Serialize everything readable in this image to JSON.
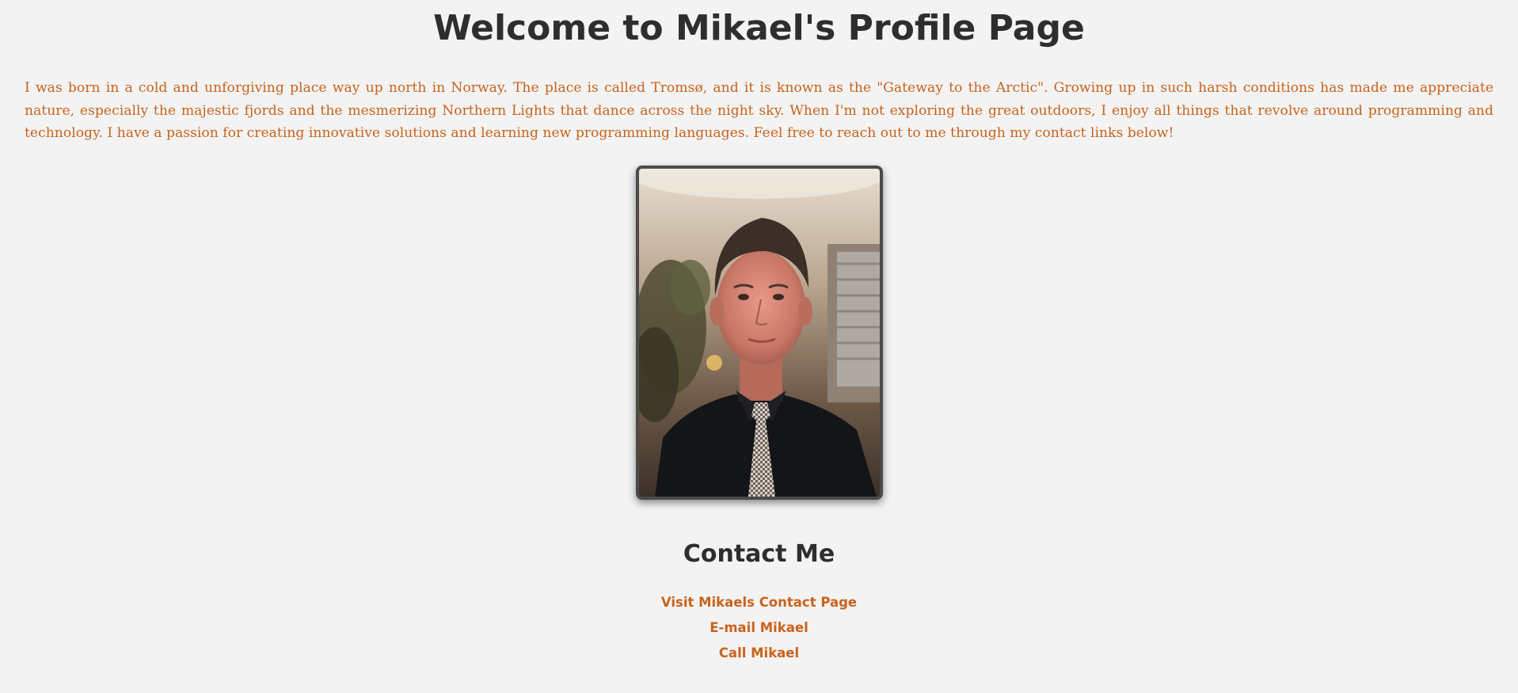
{
  "header": {
    "title": "Welcome to Mikael's Profile Page"
  },
  "bio": {
    "text": "I was born in a cold and unforgiving place way up north in Norway. The place is called Tromsø, and it is known as the \"Gateway to the Arctic\". Growing up in such harsh conditions has made me appreciate nature, especially the majestic fjords and the mesmerizing Northern Lights that dance across the night sky. When I'm not exploring the great outdoors, I enjoy all things that revolve around programming and technology. I have a passion for creating innovative solutions and learning new programming languages. Feel free to reach out to me through my contact links below!"
  },
  "photo": {
    "subject": "portrait of a man in dark shirt and checkered tie"
  },
  "contact": {
    "heading": "Contact Me",
    "links": [
      {
        "label": "Visit Mikaels Contact Page"
      },
      {
        "label": "E-mail Mikael"
      },
      {
        "label": "Call Mikael"
      }
    ]
  },
  "colors": {
    "background": "#f3f3f3",
    "heading": "#2e2e2e",
    "accent": "#c8631b"
  }
}
